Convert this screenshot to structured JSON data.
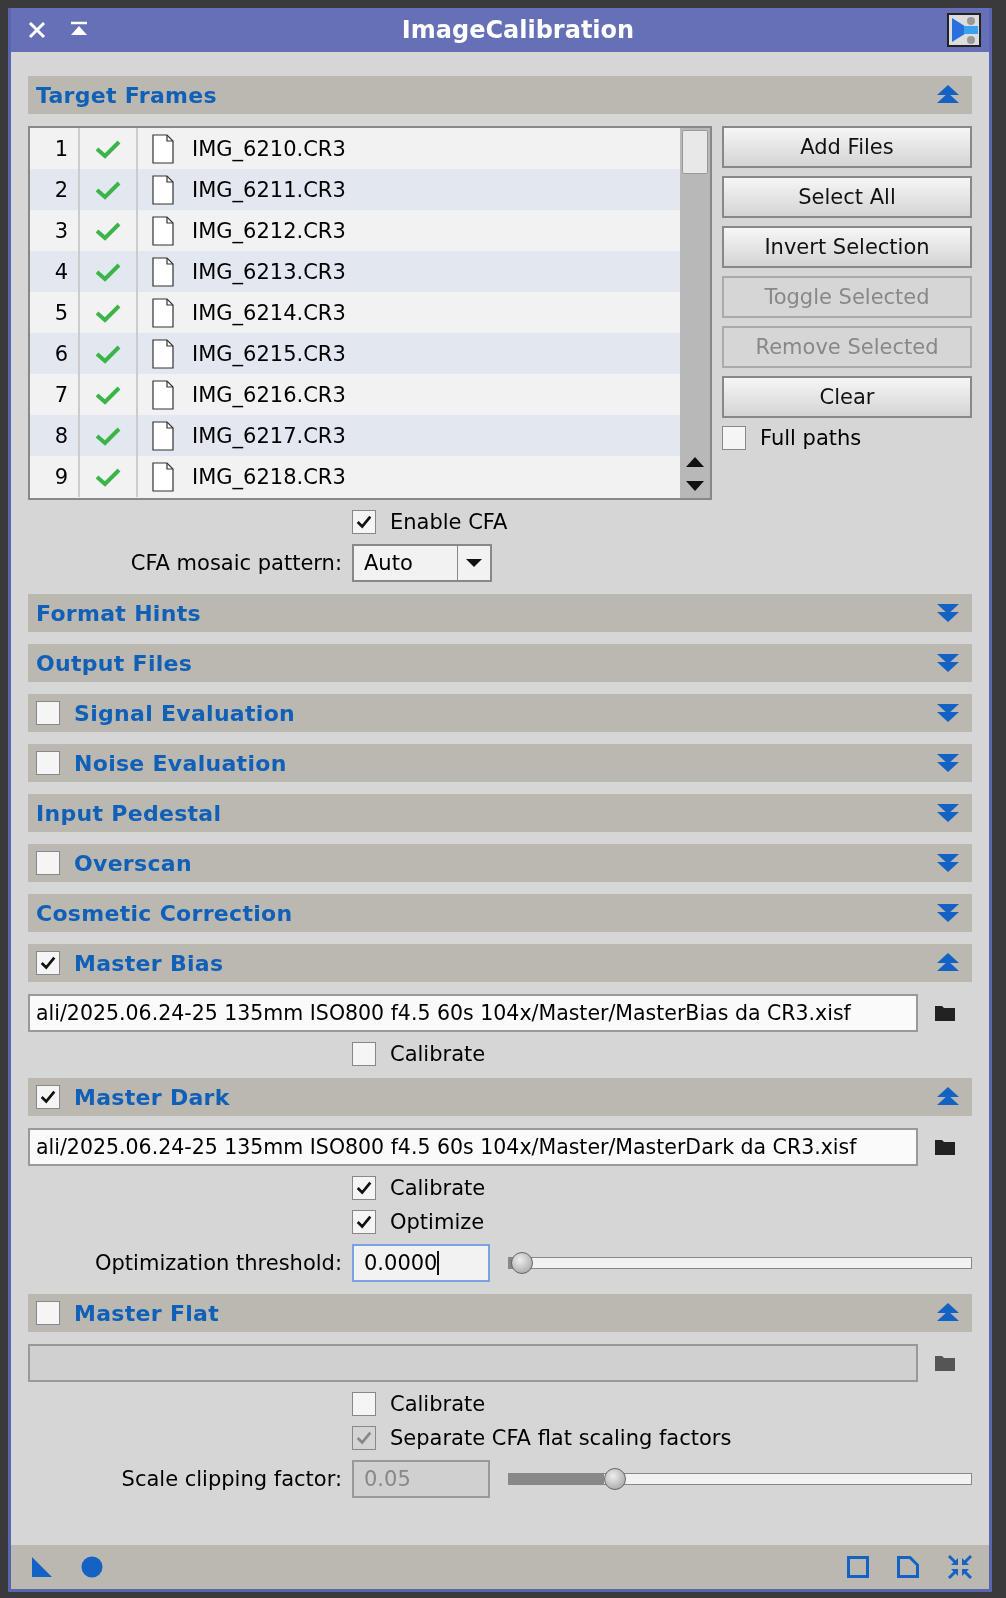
{
  "window": {
    "title": "ImageCalibration"
  },
  "sections": [
    {
      "title": "Target Frames",
      "expanded": true,
      "content": {
        "kind": "frames",
        "files": [
          {
            "index": "1",
            "name": "IMG_6210.CR3",
            "enabled": true
          },
          {
            "index": "2",
            "name": "IMG_6211.CR3",
            "enabled": true
          },
          {
            "index": "3",
            "name": "IMG_6212.CR3",
            "enabled": true
          },
          {
            "index": "4",
            "name": "IMG_6213.CR3",
            "enabled": true
          },
          {
            "index": "5",
            "name": "IMG_6214.CR3",
            "enabled": true
          },
          {
            "index": "6",
            "name": "IMG_6215.CR3",
            "enabled": true
          },
          {
            "index": "7",
            "name": "IMG_6216.CR3",
            "enabled": true
          },
          {
            "index": "8",
            "name": "IMG_6217.CR3",
            "enabled": true
          },
          {
            "index": "9",
            "name": "IMG_6218.CR3",
            "enabled": true
          }
        ],
        "buttons": [
          {
            "label": "Add Files",
            "disabled": false
          },
          {
            "label": "Select All",
            "disabled": false
          },
          {
            "label": "Invert Selection",
            "disabled": false
          },
          {
            "label": "Toggle Selected",
            "disabled": true
          },
          {
            "label": "Remove Selected",
            "disabled": true
          },
          {
            "label": "Clear",
            "disabled": false
          }
        ],
        "full_paths": {
          "label": "Full paths",
          "checked": false
        },
        "enable_cfa": {
          "label": "Enable CFA",
          "checked": true
        },
        "cfa_pattern": {
          "label": "CFA mosaic pattern:",
          "value": "Auto"
        }
      }
    },
    {
      "title": "Format Hints",
      "expanded": false
    },
    {
      "title": "Output Files",
      "expanded": false
    },
    {
      "title": "Signal Evaluation",
      "expanded": false,
      "checked": false
    },
    {
      "title": "Noise Evaluation",
      "expanded": false,
      "checked": false
    },
    {
      "title": "Input Pedestal",
      "expanded": false
    },
    {
      "title": "Overscan",
      "expanded": false,
      "checked": false
    },
    {
      "title": "Cosmetic Correction",
      "expanded": false
    },
    {
      "title": "Master Bias",
      "expanded": true,
      "checked": true,
      "content": {
        "kind": "master",
        "file_field": {
          "value": "ali/2025.06.24-25 135mm ISO800 f4.5 60s 104x/Master/MasterBias da CR3.xisf",
          "disabled": false
        },
        "options": [
          {
            "label": "Calibrate",
            "checked": false,
            "disabled": false
          }
        ]
      }
    },
    {
      "title": "Master Dark",
      "expanded": true,
      "checked": true,
      "content": {
        "kind": "master",
        "file_field": {
          "value": "ali/2025.06.24-25 135mm ISO800 f4.5 60s 104x/Master/MasterDark da CR3.xisf",
          "disabled": false
        },
        "options": [
          {
            "label": "Calibrate",
            "checked": true,
            "disabled": false
          },
          {
            "label": "Optimize",
            "checked": true,
            "disabled": false
          }
        ],
        "param": {
          "label": "Optimization threshold:",
          "value": "0.0000",
          "level": 0.03,
          "disabled": false,
          "focused": true
        }
      }
    },
    {
      "title": "Master Flat",
      "expanded": true,
      "checked": false,
      "content": {
        "kind": "master",
        "file_field": {
          "disabled": true
        },
        "options": [
          {
            "label": "Calibrate",
            "checked": false,
            "disabled": false
          },
          {
            "label": "Separate CFA flat scaling factors",
            "checked": true,
            "disabled": true
          }
        ],
        "param": {
          "label": "Scale clipping factor:",
          "value": "0.05",
          "level": 0.23,
          "disabled": true,
          "focused": false
        }
      }
    }
  ]
}
